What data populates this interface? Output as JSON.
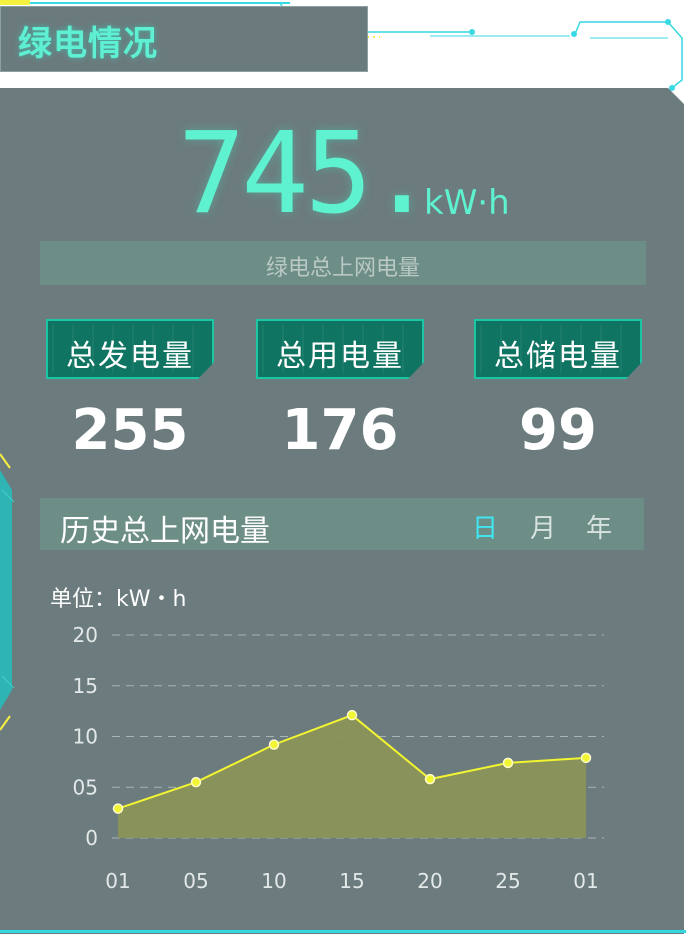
{
  "header": {
    "title": "绿电情况"
  },
  "summary": {
    "total_value": "745.",
    "unit": "kW·h",
    "label": "绿电总上网电量"
  },
  "stats": [
    {
      "label": "总发电量",
      "value": "255"
    },
    {
      "label": "总用电量",
      "value": "176"
    },
    {
      "label": "总储电量",
      "value": "99"
    }
  ],
  "history": {
    "title": "历史总上网电量",
    "tabs": [
      {
        "label": "日",
        "active": true
      },
      {
        "label": "月",
        "active": false
      },
      {
        "label": "年",
        "active": false
      }
    ],
    "unit_label": "单位：kW・h"
  },
  "colors": {
    "accent": "#5ef2d0",
    "line": "#f2f531",
    "area": "#8a9459",
    "panel": "#6c7b7d",
    "tab_active": "#3fe6f0"
  },
  "chart_data": {
    "type": "area",
    "categories": [
      "01",
      "05",
      "10",
      "15",
      "20",
      "25",
      "01"
    ],
    "series": [
      {
        "values": [
          2.9,
          5.5,
          9.2,
          12.1,
          5.8,
          7.4,
          7.9
        ]
      }
    ],
    "title": "",
    "xlabel": "",
    "ylabel": "",
    "ylim": [
      0,
      20
    ],
    "y_ticks": [
      "0",
      "05",
      "10",
      "15",
      "20"
    ],
    "grid": true
  }
}
